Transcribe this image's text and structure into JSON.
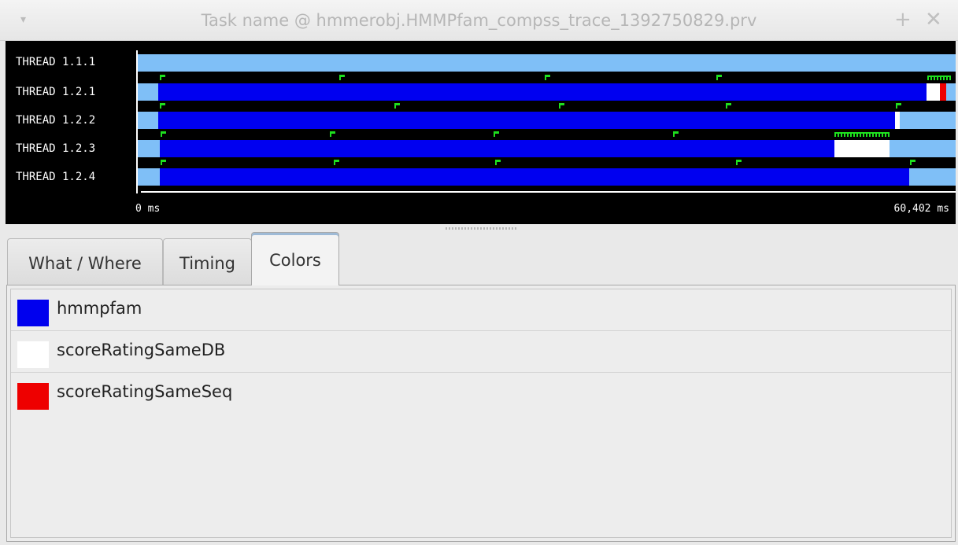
{
  "window": {
    "title": "Task name @ hmmerobj.HMMPfam_compss_trace_1392750829.prv",
    "menu_glyph": "▾",
    "plus_glyph": "+",
    "close_glyph": "✕"
  },
  "timeline": {
    "threads": [
      "THREAD 1.1.1",
      "THREAD 1.2.1",
      "THREAD 1.2.2",
      "THREAD 1.2.3",
      "THREAD 1.2.4"
    ],
    "axis_start": "0 ms",
    "axis_end": "60,402 ms"
  },
  "tabs": [
    {
      "label": "What / Where",
      "active": false
    },
    {
      "label": "Timing",
      "active": false
    },
    {
      "label": "Colors",
      "active": true
    }
  ],
  "legend": [
    {
      "label": "hmmpfam",
      "color": "#0000ee"
    },
    {
      "label": "scoreRatingSameDB",
      "color": "#ffffff"
    },
    {
      "label": "scoreRatingSameSeq",
      "color": "#ee0000"
    }
  ],
  "colors": {
    "idle": "#7fbff7",
    "running": "#0000f0",
    "event_flag": "#1ee01e"
  }
}
